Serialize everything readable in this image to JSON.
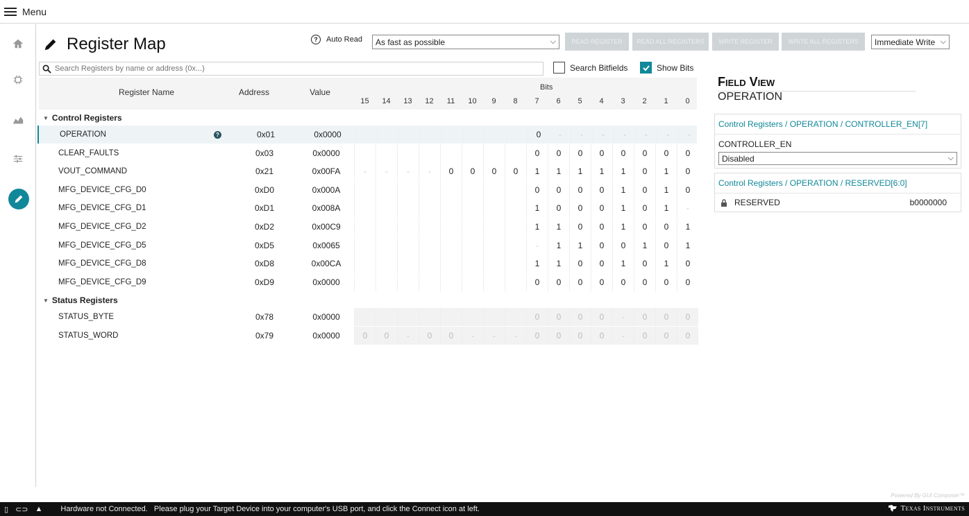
{
  "topbar": {
    "menu_label": "Menu"
  },
  "nav": [
    {
      "icon": "home-icon"
    },
    {
      "icon": "chip-icon"
    },
    {
      "icon": "area-chart-icon"
    },
    {
      "icon": "sliders-icon"
    },
    {
      "icon": "pencil-icon",
      "active": true
    }
  ],
  "header": {
    "title": "Register Map",
    "auto_read_label": "Auto Read",
    "auto_read_value": "As fast as possible",
    "buttons": [
      "READ REGISTER",
      "READ ALL REGISTERS",
      "WRITE REGISTER",
      "WRITE ALL REGISTERS"
    ],
    "write_mode": "Immediate Write"
  },
  "search": {
    "placeholder": "Search Registers by name or address (0x...)",
    "search_bitfields_label": "Search Bitfields",
    "show_bits_label": "Show Bits"
  },
  "table": {
    "headers": {
      "name": "Register Name",
      "address": "Address",
      "value": "Value",
      "bits": "Bits"
    },
    "bit_headers": [
      "15",
      "14",
      "13",
      "12",
      "11",
      "10",
      "9",
      "8",
      "7",
      "6",
      "5",
      "4",
      "3",
      "2",
      "1",
      "0"
    ],
    "groups": [
      {
        "name": "Control Registers",
        "rows": [
          {
            "name": "OPERATION",
            "address": "0x01",
            "value": "0x0000",
            "bits": [
              "",
              "",
              "",
              "",
              "",
              "",
              "",
              "",
              "0",
              "-",
              "-",
              "-",
              "-",
              "-",
              "-",
              "-"
            ],
            "selected": true
          },
          {
            "name": "CLEAR_FAULTS",
            "address": "0x03",
            "value": "0x0000",
            "bits": [
              "",
              "",
              "",
              "",
              "",
              "",
              "",
              "",
              "0",
              "0",
              "0",
              "0",
              "0",
              "0",
              "0",
              "0"
            ]
          },
          {
            "name": "VOUT_COMMAND",
            "address": "0x21",
            "value": "0x00FA",
            "bits": [
              "-",
              "-",
              "-",
              "-",
              "-",
              "0",
              "0",
              "0",
              "0",
              "1",
              "1",
              "1",
              "1",
              "1",
              "0",
              "1",
              "0"
            ]
          },
          {
            "name": "MFG_DEVICE_CFG_D0",
            "address": "0xD0",
            "value": "0x000A",
            "bits": [
              "",
              "",
              "",
              "",
              "",
              "",
              "",
              "",
              "0",
              "0",
              "0",
              "0",
              "1",
              "0",
              "1",
              "0"
            ]
          },
          {
            "name": "MFG_DEVICE_CFG_D1",
            "address": "0xD1",
            "value": "0x008A",
            "bits": [
              "",
              "",
              "",
              "",
              "",
              "",
              "",
              "",
              "1",
              "0",
              "0",
              "0",
              "1",
              "0",
              "1",
              "-"
            ]
          },
          {
            "name": "MFG_DEVICE_CFG_D2",
            "address": "0xD2",
            "value": "0x00C9",
            "bits": [
              "",
              "",
              "",
              "",
              "",
              "",
              "",
              "",
              "1",
              "1",
              "0",
              "0",
              "1",
              "0",
              "0",
              "1"
            ]
          },
          {
            "name": "MFG_DEVICE_CFG_D5",
            "address": "0xD5",
            "value": "0x0065",
            "bits": [
              "",
              "",
              "",
              "",
              "",
              "",
              "",
              "",
              "-",
              "1",
              "1",
              "0",
              "0",
              "1",
              "0",
              "1"
            ]
          },
          {
            "name": "MFG_DEVICE_CFG_D8",
            "address": "0xD8",
            "value": "0x00CA",
            "bits": [
              "",
              "",
              "",
              "",
              "",
              "",
              "",
              "",
              "1",
              "1",
              "0",
              "0",
              "1",
              "0",
              "1",
              "0"
            ]
          },
          {
            "name": "MFG_DEVICE_CFG_D9",
            "address": "0xD9",
            "value": "0x0000",
            "bits": [
              "",
              "",
              "",
              "",
              "",
              "",
              "",
              "",
              "0",
              "0",
              "0",
              "0",
              "0",
              "0",
              "0",
              "0"
            ]
          }
        ]
      },
      {
        "name": "Status Registers",
        "rows": [
          {
            "name": "STATUS_BYTE",
            "address": "0x78",
            "value": "0x0000",
            "bits": [
              "",
              "",
              "",
              "",
              "",
              "",
              "",
              "",
              "0",
              "0",
              "0",
              "0",
              "-",
              "0",
              "0",
              "0"
            ],
            "readonly": true
          },
          {
            "name": "STATUS_WORD",
            "address": "0x79",
            "value": "0x0000",
            "bits": [
              "0",
              "0",
              "-",
              "0",
              "0",
              "-",
              "-",
              "-",
              "0",
              "0",
              "0",
              "0",
              "-",
              "0",
              "0",
              "0"
            ],
            "readonly": true
          }
        ]
      }
    ]
  },
  "field_view": {
    "title": "Field View",
    "register": "OPERATION",
    "cards": [
      {
        "path": "Control Registers / OPERATION / CONTROLLER_EN[7]",
        "label": "CONTROLLER_EN",
        "select_value": "Disabled"
      },
      {
        "path": "Control Registers / OPERATION / RESERVED[6:0]",
        "field": "RESERVED",
        "field_value": "b0000000"
      }
    ]
  },
  "footer": {
    "powered": "Powered By GUI Composer™",
    "status_text": "Hardware not Connected.   Please plug your Target Device into your computer's USB port, and click the Connect icon at left.",
    "brand": "Texas Instruments"
  }
}
